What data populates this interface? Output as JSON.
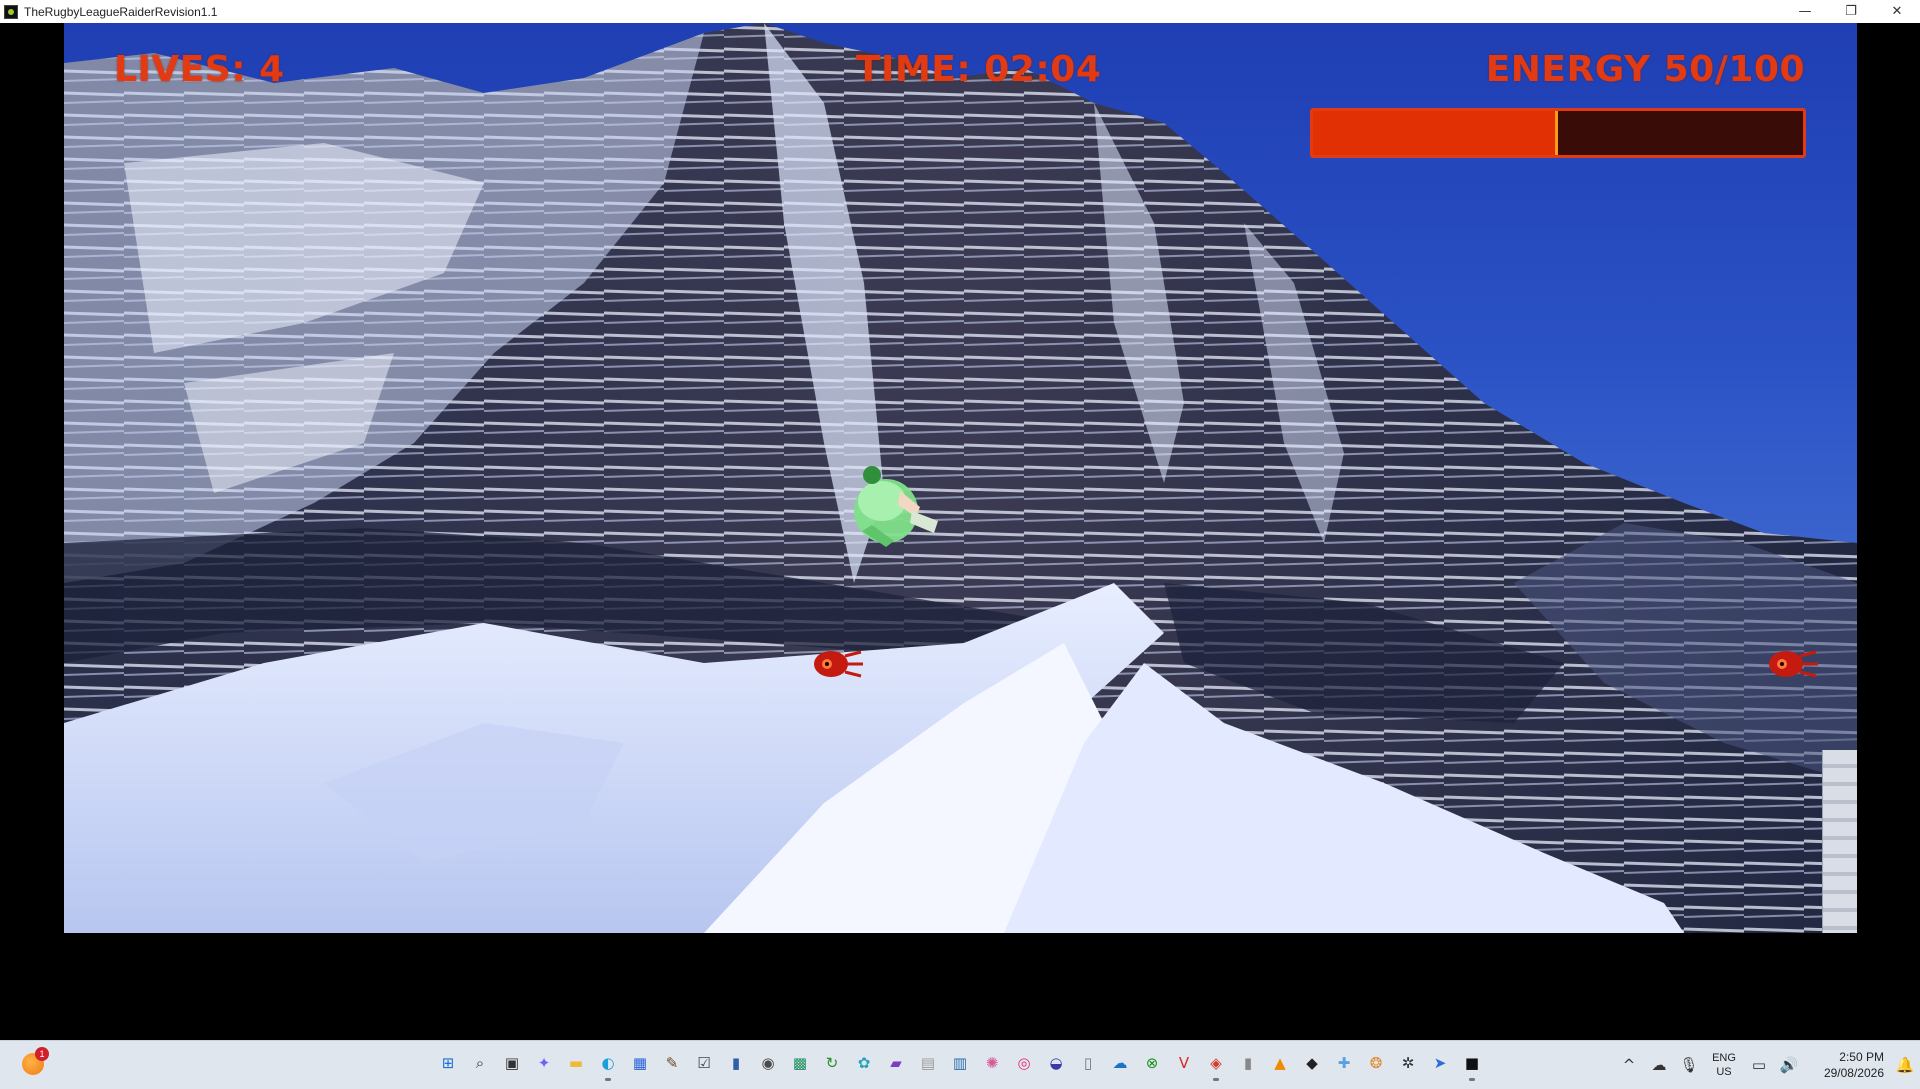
{
  "window": {
    "title": "TheRugbyLeagueRaiderRevision1.1",
    "controls": {
      "minimize": "—",
      "restore": "❐",
      "close": "✕"
    }
  },
  "hud": {
    "lives_text": "LIVES: 4",
    "time_text": "TIME: 02:04",
    "energy_text": "ENERGY 50/100",
    "energy_fraction": 0.5,
    "text_color": "#e23a12"
  },
  "scene": {
    "background": "snowy-mountain",
    "player": "player-sprite",
    "enemies": [
      "enemy-sprite",
      "enemy-sprite"
    ]
  },
  "taskbar": {
    "notification_count": "1",
    "pinned_icons": [
      {
        "name": "start-icon",
        "glyph": "⊞",
        "color": "#1e6fd9"
      },
      {
        "name": "search-icon",
        "glyph": "⌕",
        "color": "#333333"
      },
      {
        "name": "task-view-icon",
        "glyph": "▣",
        "color": "#333333"
      },
      {
        "name": "copilot-icon",
        "glyph": "✦",
        "color": "#7a5cff"
      },
      {
        "name": "file-explorer-icon",
        "glyph": "▬",
        "color": "#f2b83a"
      },
      {
        "name": "edge-icon",
        "glyph": "◐",
        "color": "#1aa0d6"
      },
      {
        "name": "store-icon",
        "glyph": "▦",
        "color": "#2a62d9"
      },
      {
        "name": "app-icon-1",
        "glyph": "✎",
        "color": "#6b4a1f"
      },
      {
        "name": "app-icon-2",
        "glyph": "☑",
        "color": "#444444"
      },
      {
        "name": "app-icon-3",
        "glyph": "▮",
        "color": "#2e5fa8"
      },
      {
        "name": "camera-icon",
        "glyph": "◉",
        "color": "#4a4a4a"
      },
      {
        "name": "app-icon-4",
        "glyph": "▩",
        "color": "#1b8f5a"
      },
      {
        "name": "app-icon-5",
        "glyph": "↻",
        "color": "#2d8c2d"
      },
      {
        "name": "app-icon-6",
        "glyph": "✿",
        "color": "#2aa3b8"
      },
      {
        "name": "app-icon-7",
        "glyph": "▰",
        "color": "#7b3fbf"
      },
      {
        "name": "app-icon-8",
        "glyph": "▤",
        "color": "#9a9a9a"
      },
      {
        "name": "app-icon-9",
        "glyph": "▥",
        "color": "#2c6fb0"
      },
      {
        "name": "app-icon-10",
        "glyph": "✺",
        "color": "#d45b9a"
      },
      {
        "name": "instagram-icon",
        "glyph": "◎",
        "color": "#e1306c"
      },
      {
        "name": "app-icon-11",
        "glyph": "◒",
        "color": "#3a3aaa"
      },
      {
        "name": "notepad-icon",
        "glyph": "▯",
        "color": "#777777"
      },
      {
        "name": "onedrive-icon",
        "glyph": "☁",
        "color": "#1a73c9"
      },
      {
        "name": "xbox-icon",
        "glyph": "⊗",
        "color": "#1f8f1f"
      },
      {
        "name": "vivaldi-icon",
        "glyph": "V",
        "color": "#d42a2a"
      },
      {
        "name": "app-icon-12",
        "glyph": "◈",
        "color": "#d43a2a"
      },
      {
        "name": "app-icon-13",
        "glyph": "▮",
        "color": "#888888"
      },
      {
        "name": "vlc-icon",
        "glyph": "▲",
        "color": "#f08a00"
      },
      {
        "name": "app-icon-14",
        "glyph": "◆",
        "color": "#222222"
      },
      {
        "name": "app-icon-15",
        "glyph": "✚",
        "color": "#5aa0e0"
      },
      {
        "name": "app-icon-16",
        "glyph": "❂",
        "color": "#e08a2a"
      },
      {
        "name": "chatgpt-icon",
        "glyph": "✲",
        "color": "#333333"
      },
      {
        "name": "app-icon-17",
        "glyph": "➤",
        "color": "#2a6fd9"
      },
      {
        "name": "game-app-icon",
        "glyph": "■",
        "color": "#111111"
      }
    ],
    "tray": {
      "chevron": "^",
      "language_line1": "ENG",
      "language_line2": "US",
      "time": "2:50 PM",
      "date": "29/08/2026"
    }
  }
}
